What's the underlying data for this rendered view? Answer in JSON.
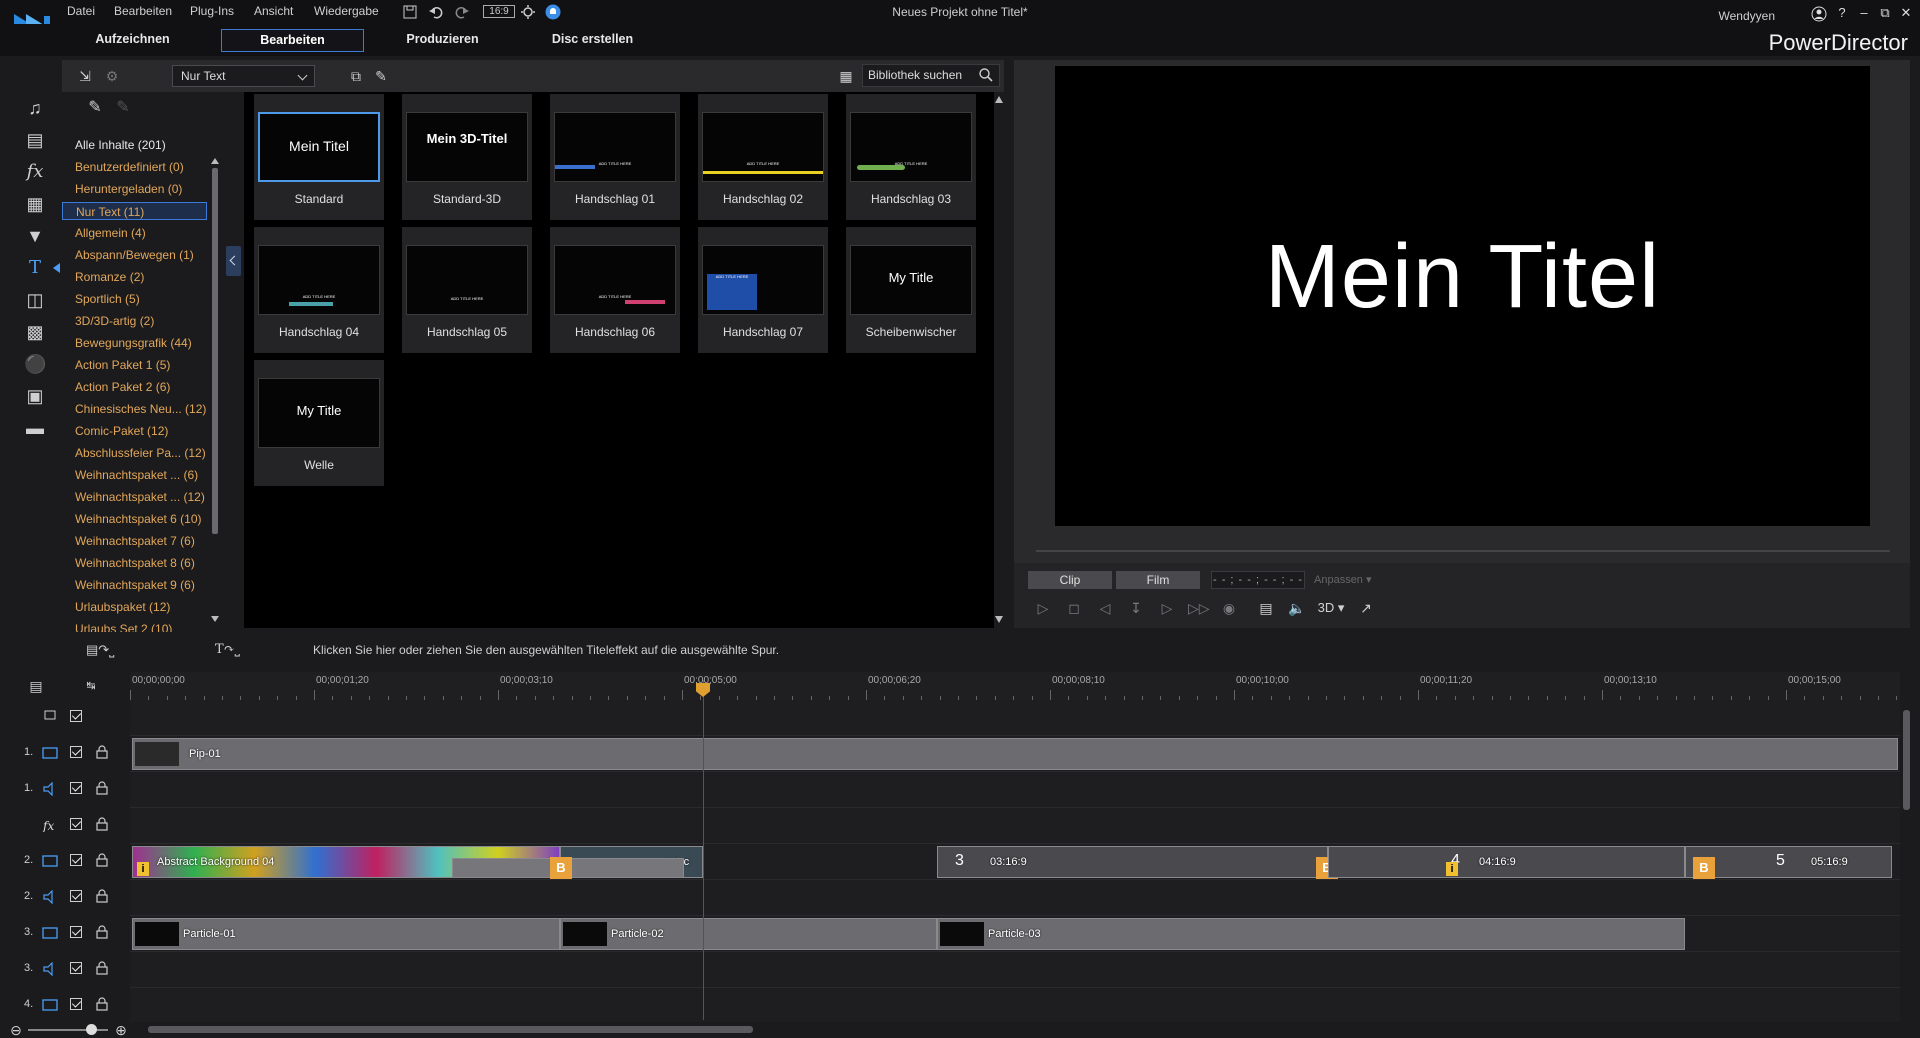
{
  "menu": {
    "items": [
      "Datei",
      "Bearbeiten",
      "Plug-Ins",
      "Ansicht",
      "Wiedergabe"
    ],
    "aspect": "16:9"
  },
  "window": {
    "title": "Neues Projekt ohne Titel*",
    "user": "Wendyyen",
    "app_name": "PowerDirector"
  },
  "modes": {
    "tabs": [
      "Aufzeichnen",
      "Bearbeiten",
      "Produzieren",
      "Disc erstellen"
    ],
    "active": "Bearbeiten"
  },
  "library": {
    "filter_value": "Nur Text",
    "search_placeholder": "Bibliothek suchen",
    "categories": [
      {
        "label": "Alle Inhalte (201)",
        "style": "white"
      },
      {
        "label": "Benutzerdefiniert  (0)",
        "style": "orange"
      },
      {
        "label": "Heruntergeladen  (0)",
        "style": "orange"
      },
      {
        "label": "Nur Text  (11)",
        "style": "selected"
      },
      {
        "label": "Allgemein  (4)",
        "style": "orange"
      },
      {
        "label": "Abspann/Bewegen  (1)",
        "style": "orange"
      },
      {
        "label": "Romanze  (2)",
        "style": "orange"
      },
      {
        "label": "Sportlich  (5)",
        "style": "orange"
      },
      {
        "label": "3D/3D-artig  (2)",
        "style": "orange"
      },
      {
        "label": "Bewegungsgrafik  (44)",
        "style": "orange"
      },
      {
        "label": "Action Paket 1  (5)",
        "style": "orange"
      },
      {
        "label": "Action Paket 2  (6)",
        "style": "orange"
      },
      {
        "label": "Chinesisches Neu...  (12)",
        "style": "orange"
      },
      {
        "label": "Comic-Paket  (12)",
        "style": "orange"
      },
      {
        "label": "Abschlussfeier Pa...  (12)",
        "style": "orange"
      },
      {
        "label": "Weihnachtspaket ...  (6)",
        "style": "orange"
      },
      {
        "label": "Weihnachtspaket ...  (12)",
        "style": "orange"
      },
      {
        "label": "Weihnachtspaket 6  (10)",
        "style": "orange"
      },
      {
        "label": "Weihnachtspaket 7  (6)",
        "style": "orange"
      },
      {
        "label": "Weihnachtspaket 8  (6)",
        "style": "orange"
      },
      {
        "label": "Weihnachtspaket 9  (6)",
        "style": "orange"
      },
      {
        "label": "Urlaubspaket  (12)",
        "style": "orange"
      },
      {
        "label": "Urlaubs Set 2  (10)",
        "style": "orange"
      }
    ],
    "tiles": [
      {
        "label": "Standard",
        "thumb_text": "Mein Titel",
        "kind": "big",
        "selected": true
      },
      {
        "label": "Standard-3D",
        "thumb_text": "Mein 3D-Titel",
        "kind": "bold"
      },
      {
        "label": "Handschlag 01",
        "thumb_text": "ADD TITLE HERE",
        "kind": "bar-blue"
      },
      {
        "label": "Handschlag 02",
        "thumb_text": "ADD TITLE HERE",
        "kind": "bar-yellow"
      },
      {
        "label": "Handschlag 03",
        "thumb_text": "ADD TITLE HERE",
        "kind": "bar-green"
      },
      {
        "label": "Handschlag 04",
        "thumb_text": "ADD TITLE HERE",
        "kind": "bar-teal"
      },
      {
        "label": "Handschlag 05",
        "thumb_text": "ADD TITLE HERE",
        "kind": "small-white"
      },
      {
        "label": "Handschlag 06",
        "thumb_text": "ADD TITLE HERE",
        "kind": "bar-pink"
      },
      {
        "label": "Handschlag 07",
        "thumb_text": "ADD TITLE HERE",
        "kind": "blue-block"
      },
      {
        "label": "Scheibenwischer",
        "thumb_text": "My Title",
        "kind": "mid"
      },
      {
        "label": "Welle",
        "thumb_text": "My Title",
        "kind": "mid"
      }
    ]
  },
  "preview": {
    "title_text": "Mein Titel",
    "tab_clip": "Clip",
    "tab_film": "Film",
    "timecode": "- - ; - - ; - - ; - -",
    "fit_label": "Anpassen",
    "mode_3d": "3D"
  },
  "timeline": {
    "hint": "Klicken Sie hier oder ziehen Sie den ausgewählten Titeleffekt auf die ausgewählte Spur.",
    "ruler": [
      "00;00;00;00",
      "00;00;01;20",
      "00;00;03;10",
      "00;00;05;00",
      "00;00;06;20",
      "00;00;08;10",
      "00;00;10;00",
      "00;00;11;20",
      "00;00;13;10",
      "00;00;15;00"
    ],
    "track_labels": [
      "",
      "1.",
      "1.",
      "",
      "2.",
      "2.",
      "3.",
      "3.",
      "4."
    ],
    "clips": {
      "pip": "Pip-01",
      "abstract": "Abstract Background 04",
      "sport": "port-c",
      "t3": "03:16:9",
      "t4": "04:16:9",
      "t5": "05:16:9",
      "n3": "3",
      "n4": "4",
      "n5": "5",
      "badge_b": "B",
      "badge_i": "i",
      "particle1": "Particle-01",
      "particle2": "Particle-02",
      "particle3": "Particle-03"
    }
  }
}
